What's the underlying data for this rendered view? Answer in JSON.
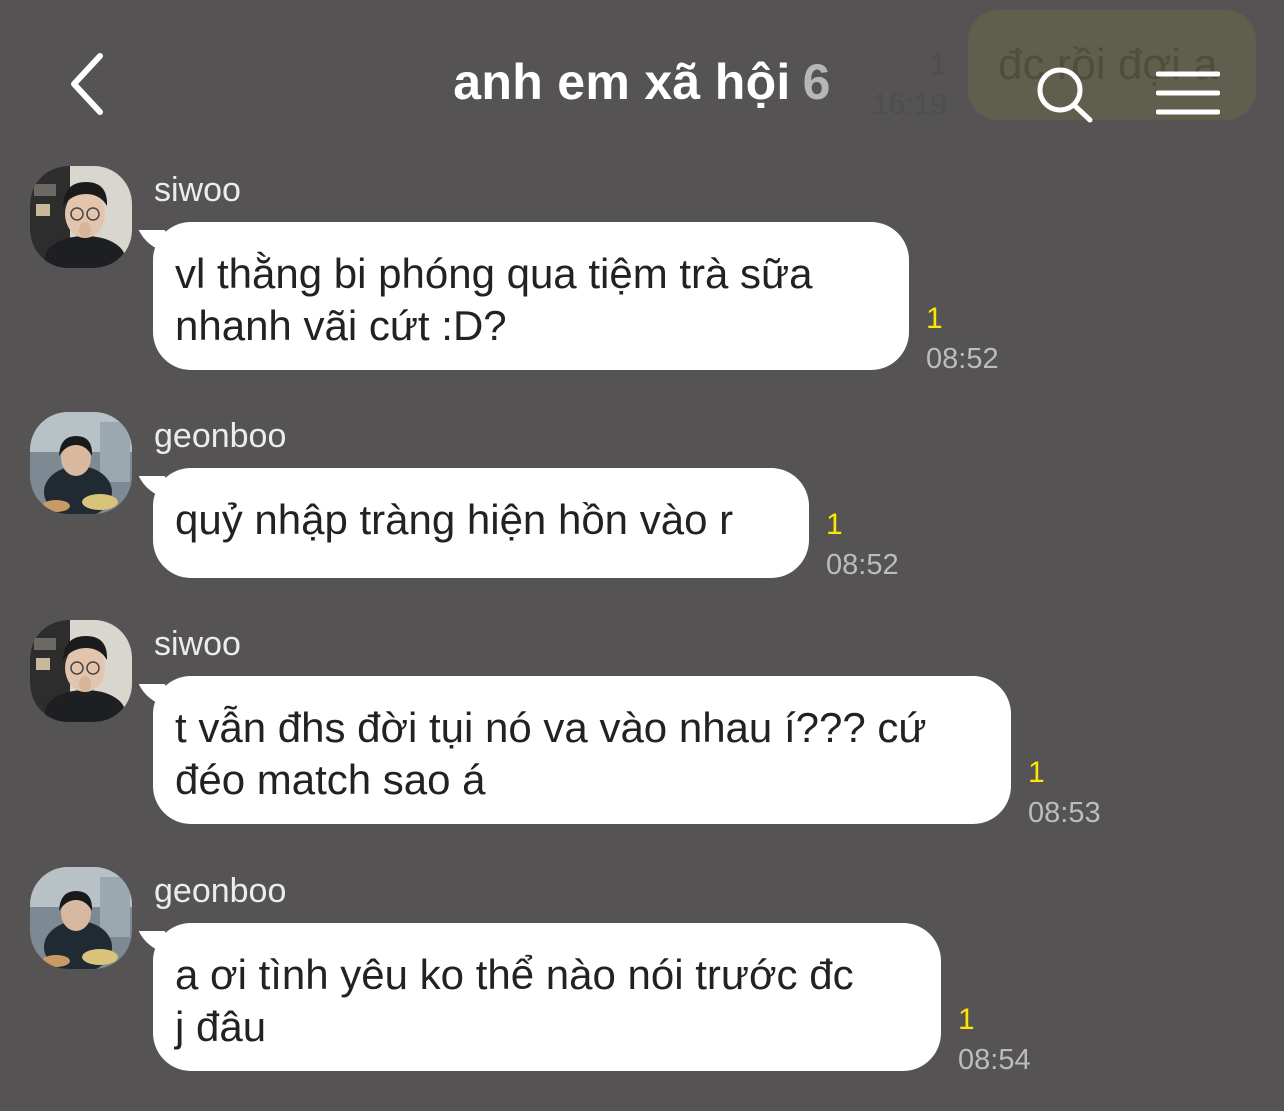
{
  "header": {
    "title": "anh em xã hội",
    "member_count": "6",
    "previous_message": {
      "text": "đc rồi đợi a",
      "unread": "1",
      "time": "16:19"
    }
  },
  "messages": [
    {
      "sender": "siwoo",
      "text": "vl thằng bi phóng qua tiệm trà sữa\nnhanh vãi cứt :D?",
      "unread": "1",
      "time": "08:52"
    },
    {
      "sender": "geonboo",
      "text": "quỷ nhập tràng hiện hồn vào r",
      "unread": "1",
      "time": "08:52"
    },
    {
      "sender": "siwoo",
      "text": "t vẫn đhs đời tụi nó va vào nhau í??? cứ\nđéo match sao á",
      "unread": "1",
      "time": "08:53"
    },
    {
      "sender": "geonboo",
      "text": "a ơi tình yêu ko thể nào nói trước đc\nj đâu",
      "unread": "1",
      "time": "08:54"
    }
  ],
  "icons": {
    "back": "chevron-left-icon",
    "search": "search-icon",
    "menu": "hamburger-menu-icon"
  },
  "colors": {
    "background": "#555354",
    "bubble": "#ffffff",
    "unread": "#ffe600",
    "time": "#bdbcbc"
  }
}
